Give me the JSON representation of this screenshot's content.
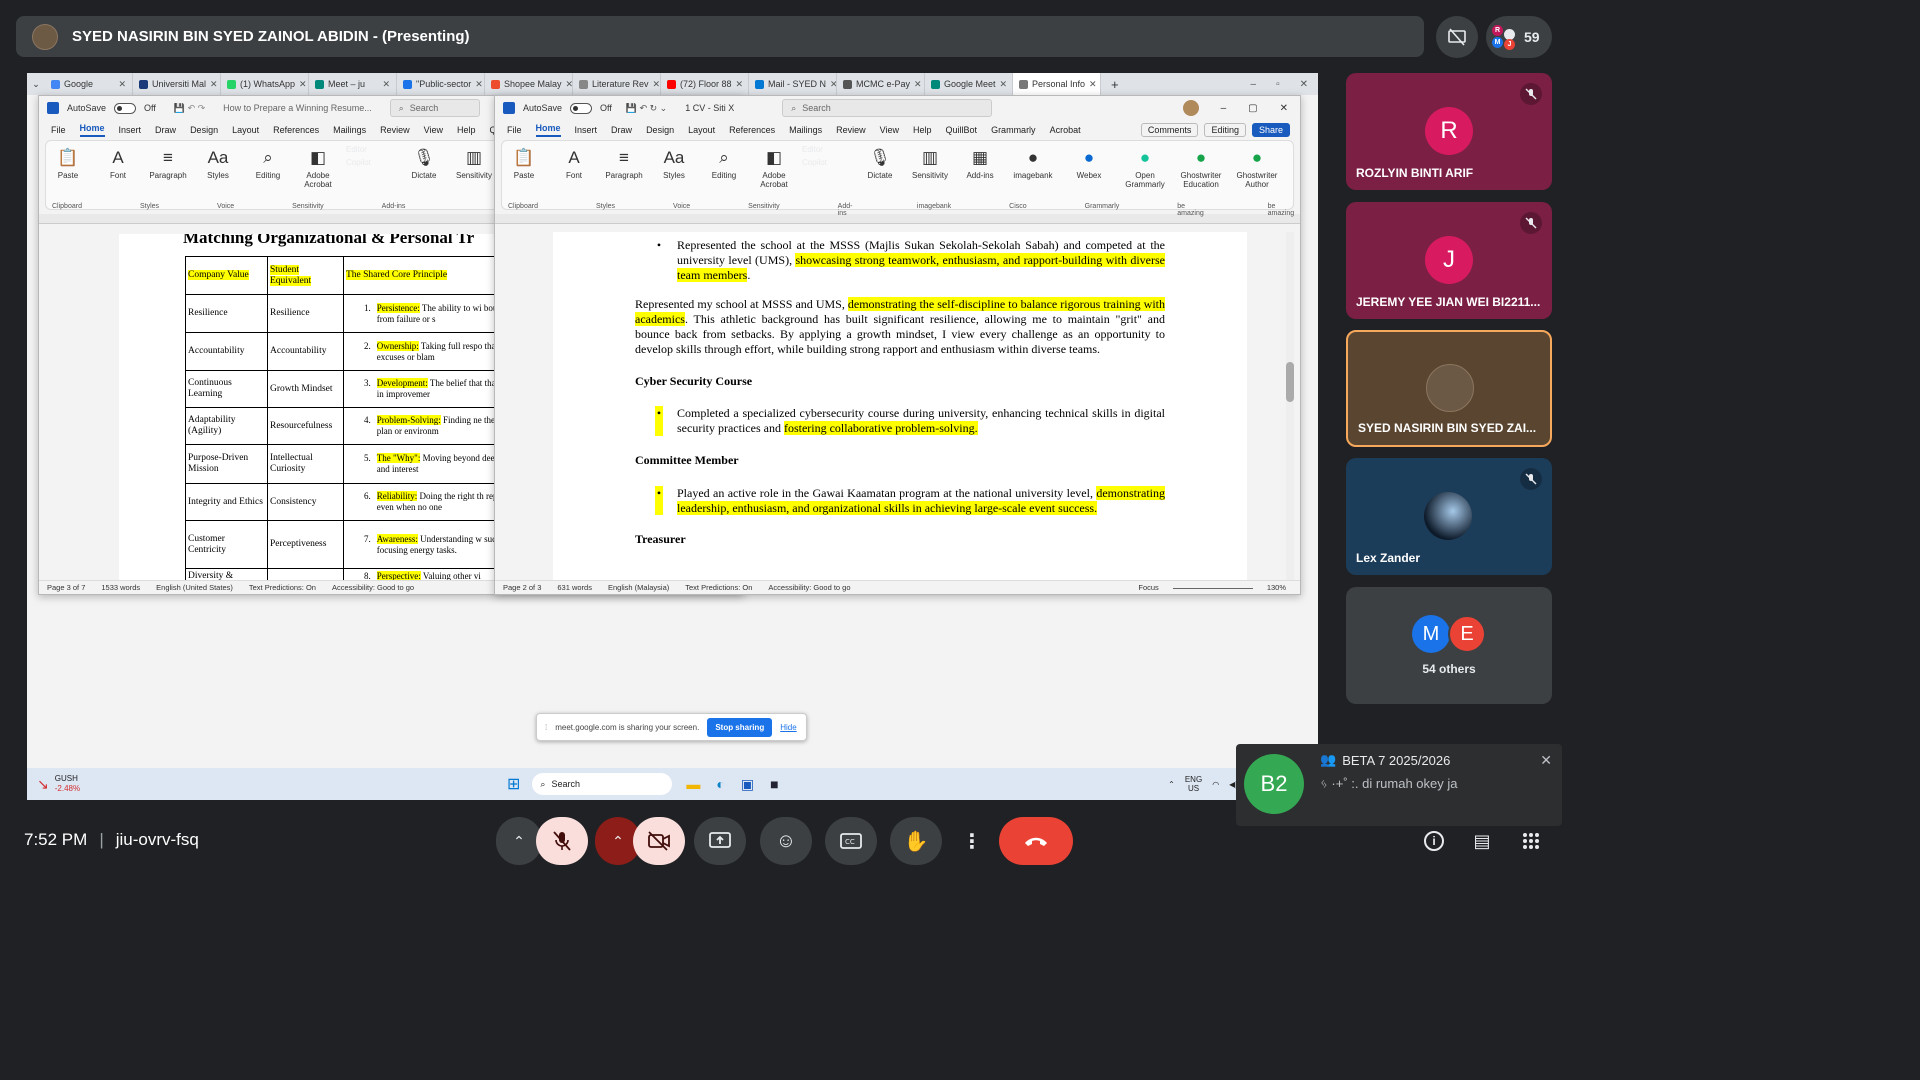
{
  "meet": {
    "presenter_title": "SYED NASIRIN BIN SYED ZAINOL ABIDIN - (Presenting)",
    "participant_count": "59",
    "dot_letters": [
      "R",
      "M",
      "J"
    ],
    "time": "7:52 PM",
    "separator": "|",
    "meeting_code": "jiu-ovrv-fsq",
    "tiles": [
      {
        "initial": "R",
        "name": "ROZLYIN BINTI ARIF"
      },
      {
        "initial": "J",
        "name": "JEREMY YEE JIAN WEI BI2211..."
      },
      {
        "initial": "",
        "name": "SYED NASIRIN BIN SYED ZAI..."
      },
      {
        "initial": "",
        "name": "Lex Zander"
      }
    ],
    "others": {
      "m": "M",
      "e": "E",
      "label": "54 others"
    },
    "chat": {
      "avatar": "B2",
      "group": "BETA 7 2025/2026",
      "message": "ᛃ ·+˚ :. di rumah okey ja"
    }
  },
  "browser": {
    "tabs": [
      "Google",
      "Universiti Mal",
      "(1) WhatsApp",
      "Meet – ju",
      "\"Public-sector",
      "Shopee Malay",
      "Literature Rev",
      "(72) Floor 88",
      "Mail - SYED N",
      "MCMC e-Pay",
      "Google Meet",
      "Personal Info"
    ],
    "tab_colors": [
      "#4285f4",
      "#1a3a7a",
      "#25d366",
      "#00897b",
      "#1a73e8",
      "#ee4d2d",
      "#888888",
      "#ff0000",
      "#0078d4",
      "#555555",
      "#00897b",
      "#777777"
    ],
    "new_tab": "+"
  },
  "word1": {
    "autosave": "AutoSave",
    "autosave_state": "Off",
    "title": "How to Prepare a Winning Resume...",
    "search": "Search",
    "menu": [
      "File",
      "Home",
      "Insert",
      "Draw",
      "Design",
      "Layout",
      "References",
      "Mailings",
      "Review",
      "View",
      "Help",
      "Qui"
    ],
    "ribbon": [
      "Paste",
      "Font",
      "Paragraph",
      "Styles",
      "Editing",
      "Adobe Acrobat",
      "Dictate",
      "Sensitivity",
      "Add-ins"
    ],
    "ribbon_side": [
      "Editor",
      "Copilot"
    ],
    "groups": [
      "Clipboard",
      "Styles",
      "Voice",
      "Sensitivity",
      "Add-ins"
    ],
    "heading": "Matching Organizational & Personal Tr",
    "table_header": [
      "Company Value",
      "Student Equivalent",
      "The Shared Core Principle"
    ],
    "rows": [
      {
        "value": "Resilience",
        "equiv": "Resilience",
        "num": "1.",
        "key": "Persistence:",
        "text": " The ability to wi bounce back from failure or s"
      },
      {
        "value": "Accountability",
        "equiv": "Accountability",
        "num": "2.",
        "key": "Ownership:",
        "text": " Taking full respo than making excuses or blam"
      },
      {
        "value": "Continuous Learning",
        "equiv": "Growth Mindset",
        "num": "3.",
        "key": "Development:",
        "text": " The belief that that investing in improvemer"
      },
      {
        "value": "Adaptability (Agility)",
        "equiv": "Resourcefulness",
        "num": "4.",
        "key": "Problem-Solving:",
        "text": " Finding ne the original plan or environm"
      },
      {
        "value": "Purpose-Driven Mission",
        "equiv": "Intellectual Curiosity",
        "num": "5.",
        "key": "The \"Why\":",
        "text": " Moving beyond deeper meaning and interest"
      },
      {
        "value": "Integrity and Ethics",
        "equiv": "Consistency",
        "num": "6.",
        "key": "Reliability:",
        "text": " Doing the right th repeatedly, even when no one"
      },
      {
        "value": "Customer Centricity",
        "equiv": "Perceptiveness",
        "num": "7.",
        "key": "Awareness:",
        "text": " Understanding w success and focusing energy tasks."
      },
      {
        "value": "Diversity &",
        "equiv": "",
        "num": "8.",
        "key": "Perspective:",
        "text": " Valuing other vi"
      }
    ],
    "status": [
      "Page 3 of 7",
      "1533 words",
      "English (United States)",
      "Text Predictions: On",
      "Accessibility: Good to go"
    ]
  },
  "word2": {
    "autosave": "AutoSave",
    "autosave_state": "Off",
    "title": "1 CV - Siti X",
    "search": "Search",
    "menu": [
      "File",
      "Home",
      "Insert",
      "Draw",
      "Design",
      "Layout",
      "References",
      "Mailings",
      "Review",
      "View",
      "Help",
      "QuillBot",
      "Grammarly",
      "Acrobat"
    ],
    "comments": "Comments",
    "editing": "Editing",
    "share": "Share",
    "ribbon": [
      "Paste",
      "Font",
      "Paragraph",
      "Styles",
      "Editing",
      "Adobe Acrobat",
      "Dictate",
      "Sensitivity",
      "Add-ins"
    ],
    "ribbon_side": [
      "Editor",
      "Copilot"
    ],
    "ribbon_right": [
      "imagebank",
      "Webex",
      "Open Grammarly",
      "Ghostwriter Education",
      "Ghostwriter Author"
    ],
    "groups": [
      "Clipboard",
      "Styles",
      "Voice",
      "Sensitivity",
      "Add-ins",
      "imagebank",
      "Cisco",
      "Grammarly",
      "be amazing",
      "be amazing"
    ],
    "b1_plain": "Represented the school at the MSSS (Majlis Sukan Sekolah-Sekolah Sabah) and competed at the university level (UMS), ",
    "b1_hl": "showcasing strong teamwork, enthusiasm, and rapport-building with diverse team members",
    "b1_end": ".",
    "p1_a": "Represented my school at MSSS and UMS, ",
    "p1_hl": "demonstrating the self-discipline to balance rigorous training with academics",
    "p1_b": ". This athletic background has built significant resilience, allowing me to maintain \"grit\" and bounce back from setbacks. By applying a growth mindset, I view every challenge as an opportunity to develop skills through effort, while building strong rapport and enthusiasm within diverse teams.",
    "h_cyber": "Cyber Security Course",
    "b2_plain": "Completed a specialized cybersecurity course during university, enhancing technical skills in digital security practices and ",
    "b2_hl": "fostering collaborative problem-solving.",
    "h_committee": "Committee Member",
    "b3_plain": "Played an active role in the Gawai Kaamatan program at the national university level, ",
    "b3_hl": "demonstrating leadership, enthusiasm, and organizational skills in achieving large-scale event success.",
    "h_treasurer": "Treasurer",
    "status": [
      "Page 2 of 3",
      "631 words",
      "English (Malaysia)",
      "Text Predictions: On",
      "Accessibility: Good to go"
    ],
    "focus": "Focus",
    "zoom": "130%"
  },
  "share_bar": {
    "text": "meet.google.com is sharing your screen.",
    "stop": "Stop sharing",
    "hide": "Hide"
  },
  "taskbar": {
    "stock_name": "GUSH",
    "stock_change": "-2.48%",
    "search": "Search",
    "lang1": "ENG",
    "lang2": "US"
  },
  "colors": {
    "meet_bg": "#202124",
    "bar": "#3c4043",
    "end_call": "#ea4335",
    "word_blue": "#185abd",
    "highlight": "#ffff00"
  }
}
